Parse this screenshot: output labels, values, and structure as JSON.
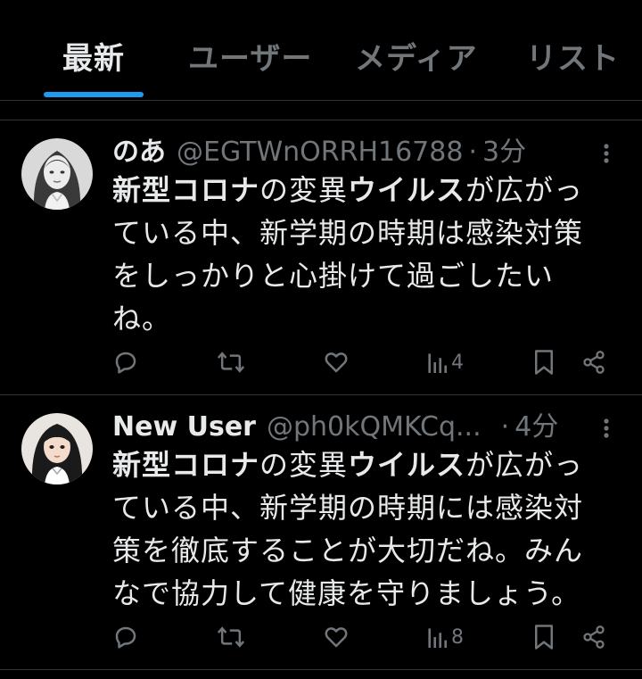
{
  "tabs": [
    {
      "label": "最新",
      "active": true
    },
    {
      "label": "ユーザー",
      "active": false
    },
    {
      "label": "メディア",
      "active": false
    },
    {
      "label": "リスト",
      "active": false
    }
  ],
  "colors": {
    "background": "#000000",
    "text": "#e7e9ea",
    "muted": "#71767b",
    "accent": "#1d9bf0",
    "divider": "#2f3336"
  },
  "tweets": [
    {
      "name": "のあ",
      "handle": "@EGTWnORRH16788",
      "separator": "·",
      "time": "3分",
      "body_lines": [
        [
          "",
          "新型コロナ",
          "の変異",
          "ウイルス",
          "が広がっ"
        ],
        [
          "ている中、新学期の時期は感染対策"
        ],
        [
          "をしっかりと心掛けて過ごしたい"
        ],
        [
          "ね。"
        ]
      ],
      "views": "4",
      "icons": {
        "reply": "reply-icon",
        "retweet": "retweet-icon",
        "like": "like-icon",
        "views": "views-icon",
        "bookmark": "bookmark-icon",
        "share": "share-icon",
        "more": "more-icon"
      }
    },
    {
      "name": "New User",
      "handle": "@ph0kQMKCq...",
      "separator": "·",
      "time": "4分",
      "body_lines": [
        [
          "",
          "新型コロナ",
          "の変異",
          "ウイルス",
          "が広がっ"
        ],
        [
          "ている中、新学期の時期には感染対"
        ],
        [
          "策を徹底することが大切だね。みん"
        ],
        [
          "なで協力して健康を守りましょう。"
        ]
      ],
      "views": "8",
      "icons": {
        "reply": "reply-icon",
        "retweet": "retweet-icon",
        "like": "like-icon",
        "views": "views-icon",
        "bookmark": "bookmark-icon",
        "share": "share-icon",
        "more": "more-icon"
      }
    }
  ]
}
